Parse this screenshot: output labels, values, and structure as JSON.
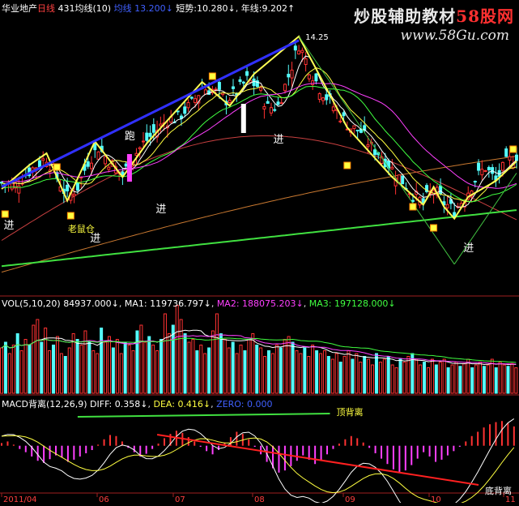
{
  "title_bar": {
    "stock_name": "华业地产",
    "period": "日线",
    "indicator": "431均线(10)",
    "ma_label": "均线",
    "ma_value": "13.200↓",
    "short_label": "短势:",
    "short_value": "10.280↓",
    "year_label": "年线:",
    "year_value": "9.202↑"
  },
  "watermark": {
    "brand_main": "炒股辅助教材",
    "brand_num": "58股网",
    "url": "www.58Gu.com"
  },
  "vol_header": {
    "label": "VOL(5,10,20)",
    "vol": "84937.000↓",
    "ma1": "MA1: 119736.797↓",
    "ma2": "MA2: 188075.203↓",
    "ma3": "MA3: 197128.000↓"
  },
  "macd_header": {
    "label": "MACD背离(12,26,9)",
    "diff": "DIFF: 0.358↓",
    "dea": "DEA: 0.416↓",
    "zero": "ZERO: 0.000"
  },
  "annotations": {
    "price_peak": "14.25",
    "jin": "进",
    "pao": "跑",
    "lao": "老鼠仓",
    "top_div": "顶背离",
    "bottom_div": "底背离"
  },
  "date_axis": [
    "2011/04",
    "06",
    "07",
    "08",
    "09",
    "10",
    "11"
  ],
  "colors": {
    "up": "#ff3232",
    "down": "#54fcfc",
    "ma_yellow": "#ffff54",
    "ma_green": "#54fc54",
    "ma_red": "#c84040",
    "trend_blue": "#3030ff",
    "year_green": "#40e040",
    "macd_white": "#ffffff"
  },
  "chart_data": {
    "type": "candlestick",
    "price_ylim": [
      7.8,
      14.8
    ],
    "price_trend_points": [
      [
        0,
        10.55
      ],
      [
        4,
        10.5
      ],
      [
        8,
        10.85
      ],
      [
        11,
        11.05
      ],
      [
        13,
        11.2
      ],
      [
        16,
        10.7
      ],
      [
        19,
        10.2
      ],
      [
        22,
        10.45
      ],
      [
        25,
        11.1
      ],
      [
        28,
        11.45
      ],
      [
        31,
        11.1
      ],
      [
        35,
        10.75
      ],
      [
        38,
        11.2
      ],
      [
        41,
        11.55
      ],
      [
        45,
        11.9
      ],
      [
        48,
        12.15
      ],
      [
        51,
        12.2
      ],
      [
        55,
        12.55
      ],
      [
        58,
        12.95
      ],
      [
        61,
        12.9
      ],
      [
        65,
        12.65
      ],
      [
        68,
        12.85
      ],
      [
        71,
        13.15
      ],
      [
        74,
        13.0
      ],
      [
        77,
        12.45
      ],
      [
        80,
        12.5
      ],
      [
        83,
        13.25
      ],
      [
        86,
        14.05
      ],
      [
        89,
        13.45
      ],
      [
        92,
        12.95
      ],
      [
        95,
        12.6
      ],
      [
        98,
        12.25
      ],
      [
        101,
        11.95
      ],
      [
        104,
        11.85
      ],
      [
        107,
        11.45
      ],
      [
        110,
        11.25
      ],
      [
        113,
        10.9
      ],
      [
        116,
        10.6
      ],
      [
        119,
        10.25
      ],
      [
        122,
        10.05
      ],
      [
        125,
        10.4
      ],
      [
        128,
        10.05
      ],
      [
        131,
        9.85
      ],
      [
        134,
        10.2
      ],
      [
        137,
        10.65
      ],
      [
        140,
        10.95
      ],
      [
        143,
        10.6
      ],
      [
        146,
        11.05
      ],
      [
        149,
        11.25
      ]
    ],
    "peak_value": 14.25,
    "vol_ylim": [
      0,
      300000
    ],
    "volume": [
      160,
      180,
      140,
      170,
      210,
      150,
      190,
      170,
      240,
      260,
      180,
      230,
      150,
      170,
      200,
      140,
      130,
      160,
      210,
      190,
      170,
      220,
      180,
      150,
      140,
      230,
      180,
      200,
      160,
      190,
      140,
      180,
      170,
      150,
      220,
      240,
      180,
      200,
      170,
      150,
      190,
      280,
      210,
      240,
      310,
      260,
      210,
      180,
      190,
      150,
      170,
      140,
      160,
      220,
      280,
      210,
      190,
      160,
      180,
      140,
      170,
      150,
      190,
      210,
      170,
      160,
      130,
      150,
      140,
      170,
      160,
      190,
      200,
      180,
      150,
      140,
      160,
      130,
      170,
      150,
      140,
      150,
      130,
      120,
      140,
      110,
      130,
      150,
      120,
      140,
      110,
      130,
      120,
      100,
      140,
      110,
      120,
      130,
      100,
      90,
      120,
      110,
      130,
      140,
      120,
      100,
      110,
      90,
      120,
      100,
      110,
      120,
      90,
      100,
      110,
      95,
      105,
      120,
      90,
      100,
      110,
      95,
      100,
      120,
      90,
      110,
      100,
      95,
      105,
      90
    ],
    "macd_ylim": [
      -0.85,
      0.75
    ],
    "macd_hist": [
      0.05,
      0.08,
      0.02,
      -0.06,
      -0.12,
      -0.2,
      -0.28,
      -0.32,
      -0.25,
      -0.18,
      -0.22,
      -0.3,
      -0.26,
      -0.2,
      -0.14,
      -0.08,
      0.02,
      0.12,
      0.2,
      0.18,
      0.08,
      -0.04,
      -0.12,
      -0.2,
      -0.15,
      -0.06,
      0.04,
      0.14,
      0.22,
      0.28,
      0.24,
      0.16,
      0.08,
      -0.02,
      -0.1,
      -0.16,
      -0.08,
      0.06,
      0.16,
      0.26,
      0.22,
      0.12,
      -0.02,
      -0.16,
      -0.3,
      -0.42,
      -0.5,
      -0.46,
      -0.38,
      -0.28,
      -0.18,
      -0.26,
      -0.34,
      -0.28,
      -0.16,
      -0.06,
      0.04,
      0.12,
      0.18,
      0.14,
      0.06,
      -0.04,
      -0.14,
      -0.24,
      -0.34,
      -0.44,
      -0.5,
      -0.46,
      -0.36,
      -0.24,
      -0.12,
      -0.2,
      -0.3,
      -0.26,
      -0.18,
      -0.1,
      -0.02,
      0.08,
      0.18,
      0.26,
      0.34,
      0.4,
      0.44,
      0.46,
      0.42,
      0.36
    ]
  }
}
